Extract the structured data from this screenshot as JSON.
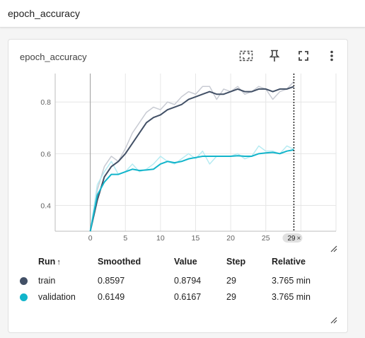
{
  "page": {
    "title": "epoch_accuracy"
  },
  "card": {
    "title": "epoch_accuracy",
    "tools": [
      "fit-to-data-icon",
      "pin-icon",
      "fullscreen-icon",
      "more-vert-icon"
    ]
  },
  "chart_data": {
    "type": "line",
    "title": "epoch_accuracy",
    "xlabel": "",
    "ylabel": "",
    "xlim": [
      -5,
      35
    ],
    "ylim": [
      0.3,
      0.91
    ],
    "x_ticks": [
      0,
      5,
      10,
      15,
      20,
      25
    ],
    "y_ticks": [
      0.4,
      0.6,
      0.8
    ],
    "grid": true,
    "cursor_step": 29,
    "cursor_label": "29",
    "series": [
      {
        "name": "train",
        "color": "#425066",
        "raw_color": "#c8cbd3",
        "x": [
          0,
          1,
          2,
          3,
          4,
          5,
          6,
          7,
          8,
          9,
          10,
          11,
          12,
          13,
          14,
          15,
          16,
          17,
          18,
          19,
          20,
          21,
          22,
          23,
          24,
          25,
          26,
          27,
          28,
          29
        ],
        "raw": [
          0.29,
          0.46,
          0.55,
          0.59,
          0.57,
          0.62,
          0.68,
          0.72,
          0.76,
          0.78,
          0.77,
          0.8,
          0.79,
          0.82,
          0.84,
          0.83,
          0.86,
          0.86,
          0.81,
          0.85,
          0.84,
          0.86,
          0.83,
          0.84,
          0.86,
          0.85,
          0.81,
          0.84,
          0.85,
          0.8794
        ],
        "smoothed": [
          0.29,
          0.42,
          0.51,
          0.55,
          0.57,
          0.6,
          0.64,
          0.68,
          0.72,
          0.74,
          0.75,
          0.77,
          0.78,
          0.79,
          0.81,
          0.82,
          0.83,
          0.84,
          0.83,
          0.83,
          0.84,
          0.85,
          0.84,
          0.84,
          0.85,
          0.85,
          0.84,
          0.85,
          0.85,
          0.8597
        ]
      },
      {
        "name": "validation",
        "color": "#12b5cb",
        "raw_color": "#b6ebf2",
        "x": [
          0,
          1,
          2,
          3,
          4,
          5,
          6,
          7,
          8,
          9,
          10,
          11,
          12,
          13,
          14,
          15,
          16,
          17,
          18,
          19,
          20,
          21,
          22,
          23,
          24,
          25,
          26,
          27,
          28,
          29
        ],
        "raw": [
          0.28,
          0.48,
          0.53,
          0.57,
          0.52,
          0.53,
          0.56,
          0.53,
          0.54,
          0.56,
          0.59,
          0.57,
          0.56,
          0.58,
          0.6,
          0.58,
          0.61,
          0.56,
          0.59,
          0.59,
          0.59,
          0.6,
          0.58,
          0.59,
          0.63,
          0.61,
          0.61,
          0.6,
          0.63,
          0.6167
        ],
        "smoothed": [
          0.28,
          0.44,
          0.49,
          0.52,
          0.52,
          0.53,
          0.54,
          0.535,
          0.537,
          0.54,
          0.56,
          0.57,
          0.565,
          0.57,
          0.58,
          0.585,
          0.59,
          0.59,
          0.59,
          0.59,
          0.59,
          0.592,
          0.59,
          0.59,
          0.6,
          0.603,
          0.605,
          0.6,
          0.61,
          0.6149
        ]
      }
    ]
  },
  "table": {
    "headers": {
      "run": "Run",
      "sort_arrow": "↑",
      "smoothed": "Smoothed",
      "value": "Value",
      "step": "Step",
      "relative": "Relative"
    },
    "rows": [
      {
        "name": "train",
        "color": "#425066",
        "smoothed": "0.8597",
        "value": "0.8794",
        "step": "29",
        "relative": "3.765 min"
      },
      {
        "name": "validation",
        "color": "#12b5cb",
        "smoothed": "0.6149",
        "value": "0.6167",
        "step": "29",
        "relative": "3.765 min"
      }
    ]
  }
}
